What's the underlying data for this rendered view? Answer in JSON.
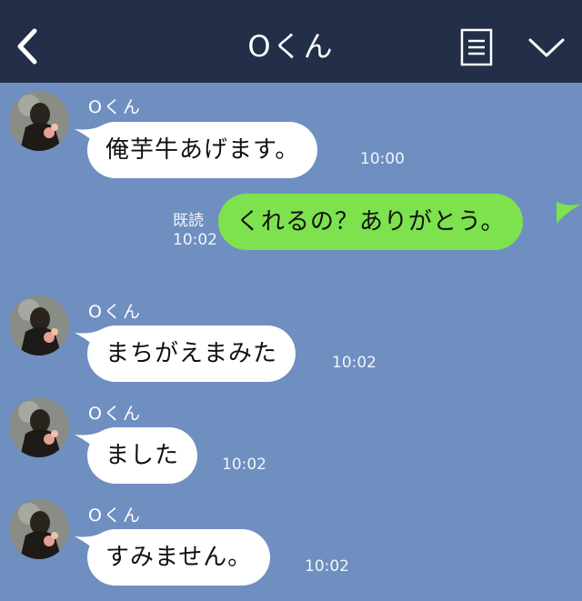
{
  "header": {
    "title": "Oくん"
  },
  "messages": [
    {
      "sender": "Oくん",
      "text": "俺芋牛あげます。",
      "time": "10:00"
    },
    {
      "text": "くれるの？ありがとう。",
      "read": "既読",
      "time": "10:02"
    },
    {
      "sender": "Oくん",
      "text": "まちがえまみた",
      "time": "10:02"
    },
    {
      "sender": "Oくん",
      "text": "ました",
      "time": "10:02"
    },
    {
      "sender": "Oくん",
      "text": "すみません。",
      "time": "10:02"
    }
  ],
  "colors": {
    "header_bg": "#232e48",
    "chat_bg": "#6f8fc1",
    "incoming_bubble": "#ffffff",
    "outgoing_bubble": "#7de24d"
  }
}
